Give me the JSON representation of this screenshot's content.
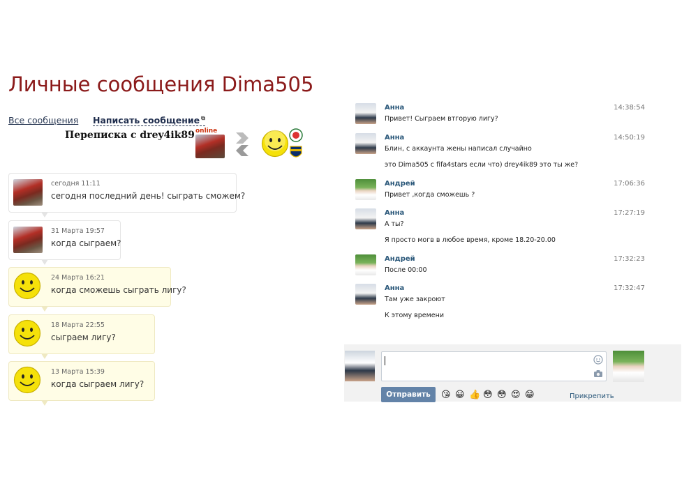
{
  "left": {
    "title": "Личные сообщения Dima505",
    "links": {
      "all_messages": "Все сообщения",
      "write_message": "Написать сообщение"
    },
    "conversation_title": "Переписка с drey4ik89",
    "online_badge": "online",
    "messages": [
      {
        "time": "сегодня 11:11",
        "text": "сегодня последний день! сыграть сможем?",
        "avatar": "photo-avatar",
        "style": "white"
      },
      {
        "time": "31 Марта 19:57",
        "text": "когда сыграем?",
        "avatar": "photo-avatar",
        "style": "white"
      },
      {
        "time": "24 Марта 16:21",
        "text": "когда сможешь сыграть лигу?",
        "avatar": "smiley-avatar",
        "style": "yellow"
      },
      {
        "time": "18 Марта 22:55",
        "text": "сыграем лигу?",
        "avatar": "smiley-avatar",
        "style": "yellow"
      },
      {
        "time": "13 Марта 15:39",
        "text": "когда сыграем лигу?",
        "avatar": "smiley-avatar",
        "style": "yellow"
      }
    ]
  },
  "right": {
    "messages": [
      {
        "name": "Анна",
        "time": "14:38:54",
        "lines": [
          "Привет! Сыграем втгорую лигу?"
        ]
      },
      {
        "name": "Анна",
        "time": "14:50:19",
        "lines": [
          "Блин, с аккаунта жены написал случайно",
          "это Dima505 с fifa4stars если что) drey4ik89 это ты же?"
        ]
      },
      {
        "name": "Андрей",
        "time": "17:06:36",
        "lines": [
          "Привет ,когда сможешь ?"
        ]
      },
      {
        "name": "Анна",
        "time": "17:27:19",
        "lines": [
          "А ты?",
          "Я просто могв в любое время, кроме 18.20-20.00"
        ]
      },
      {
        "name": "Андрей",
        "time": "17:32:23",
        "lines": [
          "После 00:00"
        ]
      },
      {
        "name": "Анна",
        "time": "17:32:47",
        "lines": [
          "Там уже закроют",
          "К этому времени"
        ]
      }
    ],
    "composer": {
      "send_label": "Отправить",
      "attach_label": "Прикрепить",
      "emojis": [
        "😘",
        "😀",
        "👍",
        "😳",
        "😳",
        "😍",
        "😁"
      ]
    }
  },
  "colors": {
    "title": "#8b1a1a",
    "link": "#2b587a",
    "send_button": "#6383a8",
    "bubble_yellow": "#fffde6"
  }
}
